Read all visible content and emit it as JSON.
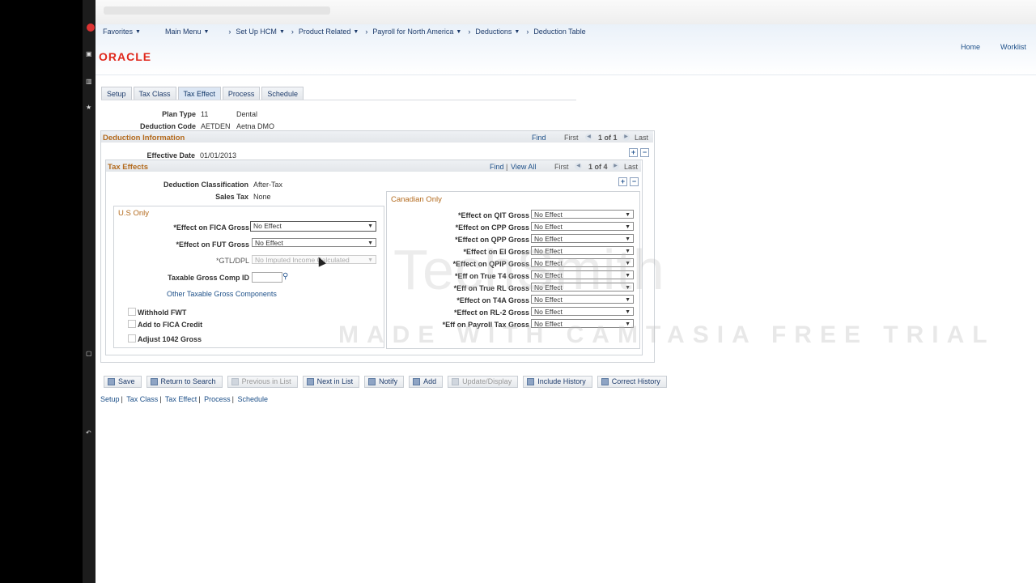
{
  "breadcrumb": {
    "items": [
      {
        "label": "Favorites",
        "dropdown": true
      },
      {
        "label": "Main Menu",
        "dropdown": true
      },
      {
        "label": "Set Up HCM",
        "dropdown": true
      },
      {
        "label": "Product Related",
        "dropdown": true
      },
      {
        "label": "Payroll for North America",
        "dropdown": true
      },
      {
        "label": "Deductions",
        "dropdown": true
      },
      {
        "label": "Deduction Table",
        "dropdown": false
      }
    ]
  },
  "header": {
    "logo": "ORACLE",
    "home": "Home",
    "worklist": "Worklist"
  },
  "tabs": [
    "Setup",
    "Tax Class",
    "Tax Effect",
    "Process",
    "Schedule"
  ],
  "active_tab": "Tax Effect",
  "plan": {
    "plan_type_label": "Plan Type",
    "plan_type_code": "11",
    "plan_type_desc": "Dental",
    "deduction_code_label": "Deduction Code",
    "deduction_code": "AETDEN",
    "deduction_desc": "Aetna DMO"
  },
  "deduction_info": {
    "title": "Deduction Information",
    "find": "Find",
    "first": "First",
    "count": "1 of 1",
    "last": "Last",
    "effective_date_label": "Effective Date",
    "effective_date": "01/01/2013"
  },
  "tax_effects": {
    "title": "Tax Effects",
    "find": "Find",
    "view_all": "View All",
    "first": "First",
    "count": "1 of 4",
    "last": "Last",
    "classification_label": "Deduction Classification",
    "classification": "After-Tax",
    "sales_tax_label": "Sales Tax",
    "sales_tax": "None"
  },
  "us_only": {
    "title": "U.S Only",
    "fica_label": "*Effect on FICA Gross",
    "fica_value": "No Effect",
    "fut_label": "*Effect on FUT Gross",
    "fut_value": "No Effect",
    "gtl_label": "*GTL/DPL",
    "gtl_value": "No Imputed Income Calculated",
    "comp_id_label": "Taxable Gross Comp ID",
    "other_link": "Other Taxable Gross Components",
    "withhold_fwt": "Withhold FWT",
    "add_fica_credit": "Add to FICA Credit",
    "adjust_1042": "Adjust 1042 Gross"
  },
  "canadian_only": {
    "title": "Canadian Only",
    "rows": [
      {
        "label": "*Effect on QIT Gross",
        "value": "No Effect"
      },
      {
        "label": "*Effect on CPP Gross",
        "value": "No Effect"
      },
      {
        "label": "*Effect on QPP Gross",
        "value": "No Effect"
      },
      {
        "label": "*Effect on EI Gross",
        "value": "No Effect"
      },
      {
        "label": "*Effect on QPIP Gross",
        "value": "No Effect"
      },
      {
        "label": "*Eff on True T4 Gross",
        "value": "No Effect"
      },
      {
        "label": "*Eff on True RL Gross",
        "value": "No Effect"
      },
      {
        "label": "*Effect on T4A Gross",
        "value": "No Effect"
      },
      {
        "label": "*Effect on RL-2 Gross",
        "value": "No Effect"
      },
      {
        "label": "*Eff on Payroll Tax Gross",
        "value": "No Effect"
      }
    ]
  },
  "toolbar": {
    "save": "Save",
    "return_to_search": "Return to Search",
    "previous_in_list": "Previous in List",
    "next_in_list": "Next in List",
    "notify": "Notify",
    "add": "Add",
    "update_display": "Update/Display",
    "include_history": "Include History",
    "correct_history": "Correct History"
  },
  "bottom_links": [
    "Setup",
    "Tax Class",
    "Tax Effect",
    "Process",
    "Schedule"
  ],
  "watermark": {
    "brand": "TechSmith",
    "text": "MADE WITH CAMTASIA FREE TRIAL"
  },
  "colors": {
    "section_title": "#b36a1d",
    "link": "#1c4f88",
    "logo": "#e0281c"
  }
}
